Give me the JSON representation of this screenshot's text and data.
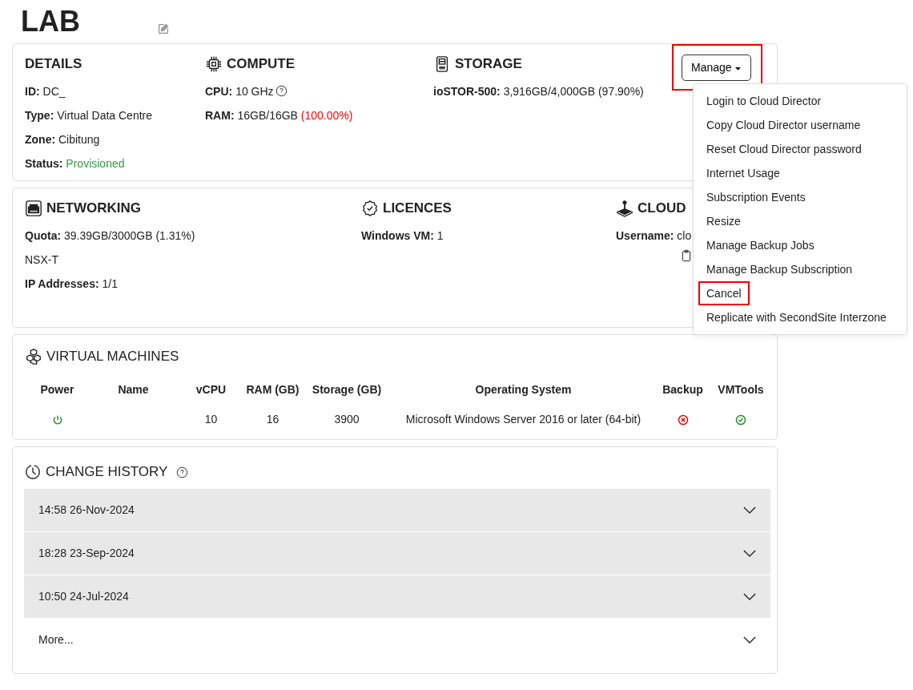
{
  "title": "LAB",
  "summary": {
    "details": {
      "heading": "DETAILS",
      "fields": [
        {
          "label": "ID:",
          "value": "DC_"
        },
        {
          "label": "Type:",
          "value": "Virtual Data Centre"
        },
        {
          "label": "Zone:",
          "value": "Cibitung"
        },
        {
          "label": "Status:",
          "value": "Provisioned",
          "color": "#2e9e3e"
        }
      ]
    },
    "compute": {
      "heading": "COMPUTE",
      "fields": [
        {
          "label": "CPU:",
          "value": "10 GHz",
          "help": true
        },
        {
          "label": "RAM:",
          "value": "16GB/16GB",
          "note": {
            "text": "(100.00%)",
            "color": "#ff0000"
          }
        }
      ]
    },
    "storage": {
      "heading": "STORAGE",
      "fields": [
        {
          "label": "ioSTOR-500:",
          "value": "3,916GB/4,000GB (97.90%)"
        }
      ]
    },
    "manage": {
      "label": "Manage",
      "expanded": true,
      "highlighted": true,
      "menu": [
        {
          "label": "Login to Cloud Director",
          "highlighted": false
        },
        {
          "label": "Copy Cloud Director username",
          "highlighted": false
        },
        {
          "label": "Reset Cloud Director password",
          "highlighted": false
        },
        {
          "label": "Internet Usage",
          "highlighted": false
        },
        {
          "label": "Subscription Events",
          "highlighted": false
        },
        {
          "label": "Resize",
          "highlighted": false
        },
        {
          "label": "Manage Backup Jobs",
          "highlighted": false
        },
        {
          "label": "Manage Backup Subscription",
          "highlighted": false
        },
        {
          "label": "Cancel",
          "highlighted": true
        },
        {
          "label": "Replicate with SecondSite Interzone",
          "highlighted": false
        }
      ]
    }
  },
  "services": {
    "networking": {
      "heading": "NETWORKING",
      "fields": [
        {
          "label": "Quota:",
          "value": "39.39GB/3000GB (1.31%)"
        },
        {
          "value": "NSX-T"
        },
        {
          "label": "IP Addresses:",
          "value": "1/1"
        }
      ]
    },
    "licences": {
      "heading": "LICENCES",
      "fields": [
        {
          "label": "Windows VM:",
          "value": "1"
        }
      ]
    },
    "cloud": {
      "heading": "CLOUD",
      "fields": [
        {
          "label": "Username:",
          "value": "clo"
        }
      ],
      "copy": true
    }
  },
  "virtual_machines": {
    "heading": "VIRTUAL MACHINES",
    "columns": [
      "Power",
      "Name",
      "vCPU",
      "RAM (GB)",
      "Storage (GB)",
      "Operating System",
      "Backup",
      "VMTools"
    ],
    "rows": [
      {
        "power_on": true,
        "vcpu": "10",
        "ram": "16",
        "storage": "3900",
        "os": "Microsoft Windows Server 2016 or later (64-bit)",
        "backup": false,
        "vmtools": true
      }
    ]
  },
  "change_history": {
    "heading": "CHANGE HISTORY",
    "help": true,
    "items": [
      {
        "kind": "entry",
        "label": "14:58 26-Nov-2024",
        "expanded": false
      },
      {
        "kind": "entry",
        "label": "18:28 23-Sep-2024",
        "expanded": false
      },
      {
        "kind": "entry",
        "label": "10:50 24-Jul-2024",
        "expanded": false
      },
      {
        "kind": "more",
        "label": "More...",
        "expanded": false
      }
    ]
  }
}
